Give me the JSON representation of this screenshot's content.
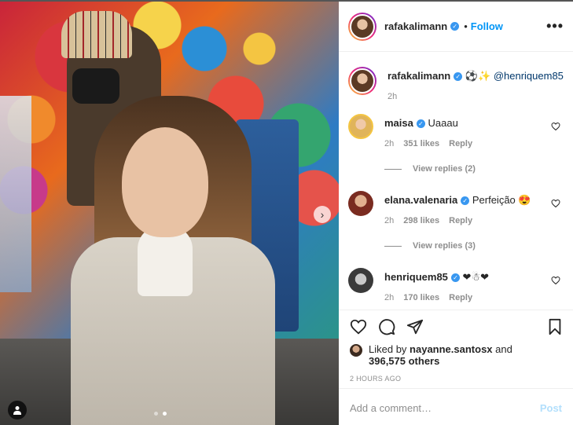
{
  "post": {
    "carousel": {
      "slide_count": 2,
      "active_slide": 2
    }
  },
  "header": {
    "username": "rafakalimann",
    "verified": true,
    "separator": "•",
    "follow_label": "Follow",
    "more_label": "•••"
  },
  "caption": {
    "username": "rafakalimann",
    "emoji": "⚽✨",
    "mention": "@henriquem85",
    "time": "2h"
  },
  "comments": [
    {
      "username": "maisa",
      "text": "Uaaau",
      "time": "2h",
      "likes": "351 likes",
      "reply_label": "Reply",
      "view_replies": "View replies (2)"
    },
    {
      "username": "elana.valenaria",
      "text": "Perfeição 😍",
      "time": "2h",
      "likes": "298 likes",
      "reply_label": "Reply",
      "view_replies": "View replies (3)"
    },
    {
      "username": "henriquem85",
      "text": "❤☃❤",
      "time": "2h",
      "likes": "170 likes",
      "reply_label": "Reply"
    }
  ],
  "likes_summary": {
    "prefix": "Liked by",
    "user": "nayanne.santosx",
    "conj": "and",
    "others": "396,575 others"
  },
  "timestamp": "2 HOURS AGO",
  "composer": {
    "placeholder": "Add a comment…",
    "post_label": "Post"
  },
  "colors": {
    "link_blue": "#0095f6",
    "verified_blue": "#3897f0",
    "post_disabled": "#b2dffc",
    "muted": "#8e8e8e"
  }
}
